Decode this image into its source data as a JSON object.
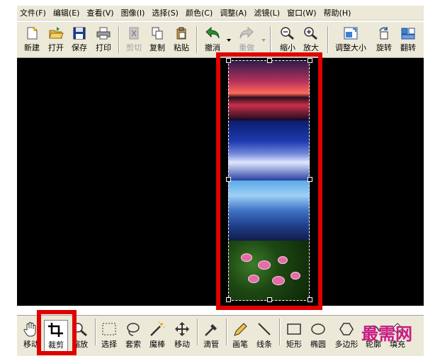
{
  "menu": [
    "文件(F)",
    "编辑(E)",
    "查看(V)",
    "图像(I)",
    "选择(S)",
    "颜色(C)",
    "调整(A)",
    "滤镜(L)",
    "窗口(W)",
    "帮助(H)"
  ],
  "toolbar": {
    "new": "新建",
    "open": "打开",
    "save": "保存",
    "print": "打印",
    "cut": "剪切",
    "copy": "复制",
    "paste": "粘贴",
    "undo": "撤消",
    "redo": "重做",
    "zoom_out": "缩小",
    "zoom_in": "放大",
    "resize": "调整大小",
    "rotate": "旋转",
    "flip": "翻转"
  },
  "tools": {
    "move_view": "移动",
    "crop": "裁剪",
    "zoom": "缩放",
    "select": "选择",
    "lasso": "套索",
    "magic_wand": "魔棒",
    "move": "移动",
    "eyedropper": "滴管",
    "pencil": "画笔",
    "line": "线条",
    "rectangle": "矩形",
    "ellipse": "椭圆",
    "polygon": "多边形",
    "outline": "轮廓",
    "fill": "填充"
  },
  "watermark": "最需网",
  "colors": {
    "highlight_red": "#e00000",
    "canvas": "#000000",
    "chrome": "#ece9d8"
  }
}
